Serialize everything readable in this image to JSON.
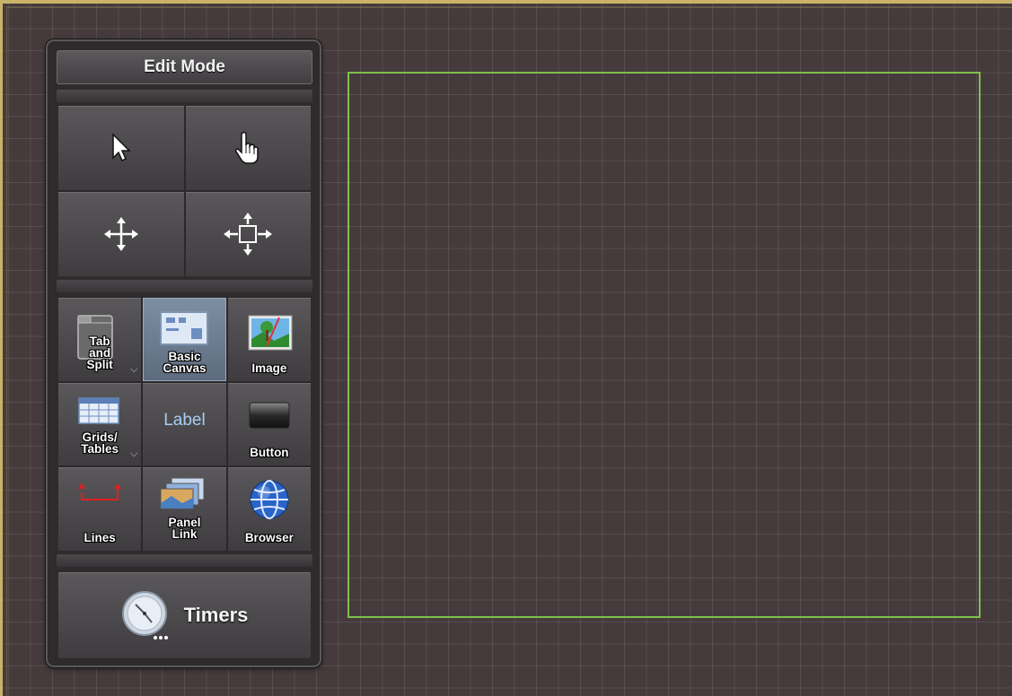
{
  "toolbox": {
    "title": "Edit Mode",
    "modes": [
      {
        "name": "select-arrow",
        "icon": "arrow-cursor-icon"
      },
      {
        "name": "hand-pointer",
        "icon": "hand-cursor-icon"
      },
      {
        "name": "move",
        "icon": "move-arrows-icon"
      },
      {
        "name": "resize",
        "icon": "resize-box-icon"
      }
    ],
    "tools": [
      {
        "label": "Tab\nand\nSplit",
        "icon": "tab-split-icon",
        "has_dropdown": true
      },
      {
        "label": "Basic\nCanvas",
        "icon": "canvas-icon",
        "selected": true
      },
      {
        "label": "Image",
        "icon": "image-icon"
      },
      {
        "label": "Grids/\nTables",
        "icon": "grid-icon",
        "has_dropdown": true
      },
      {
        "label": "Label",
        "icon": "label-text"
      },
      {
        "label": "Button",
        "icon": "button-icon"
      },
      {
        "label": "Lines",
        "icon": "lines-icon"
      },
      {
        "label": "Panel\nLink",
        "icon": "panel-link-icon"
      },
      {
        "label": "Browser",
        "icon": "globe-icon"
      }
    ],
    "dropdown_glyph": "⌵",
    "timers_label": "Timers",
    "timers_icon": "clock-icon"
  },
  "colors": {
    "canvas_border": "#7fc04a",
    "window_border": "#c9b36a",
    "selected_tool": "#7e8ea3",
    "label_text": "#a8cdf3"
  }
}
